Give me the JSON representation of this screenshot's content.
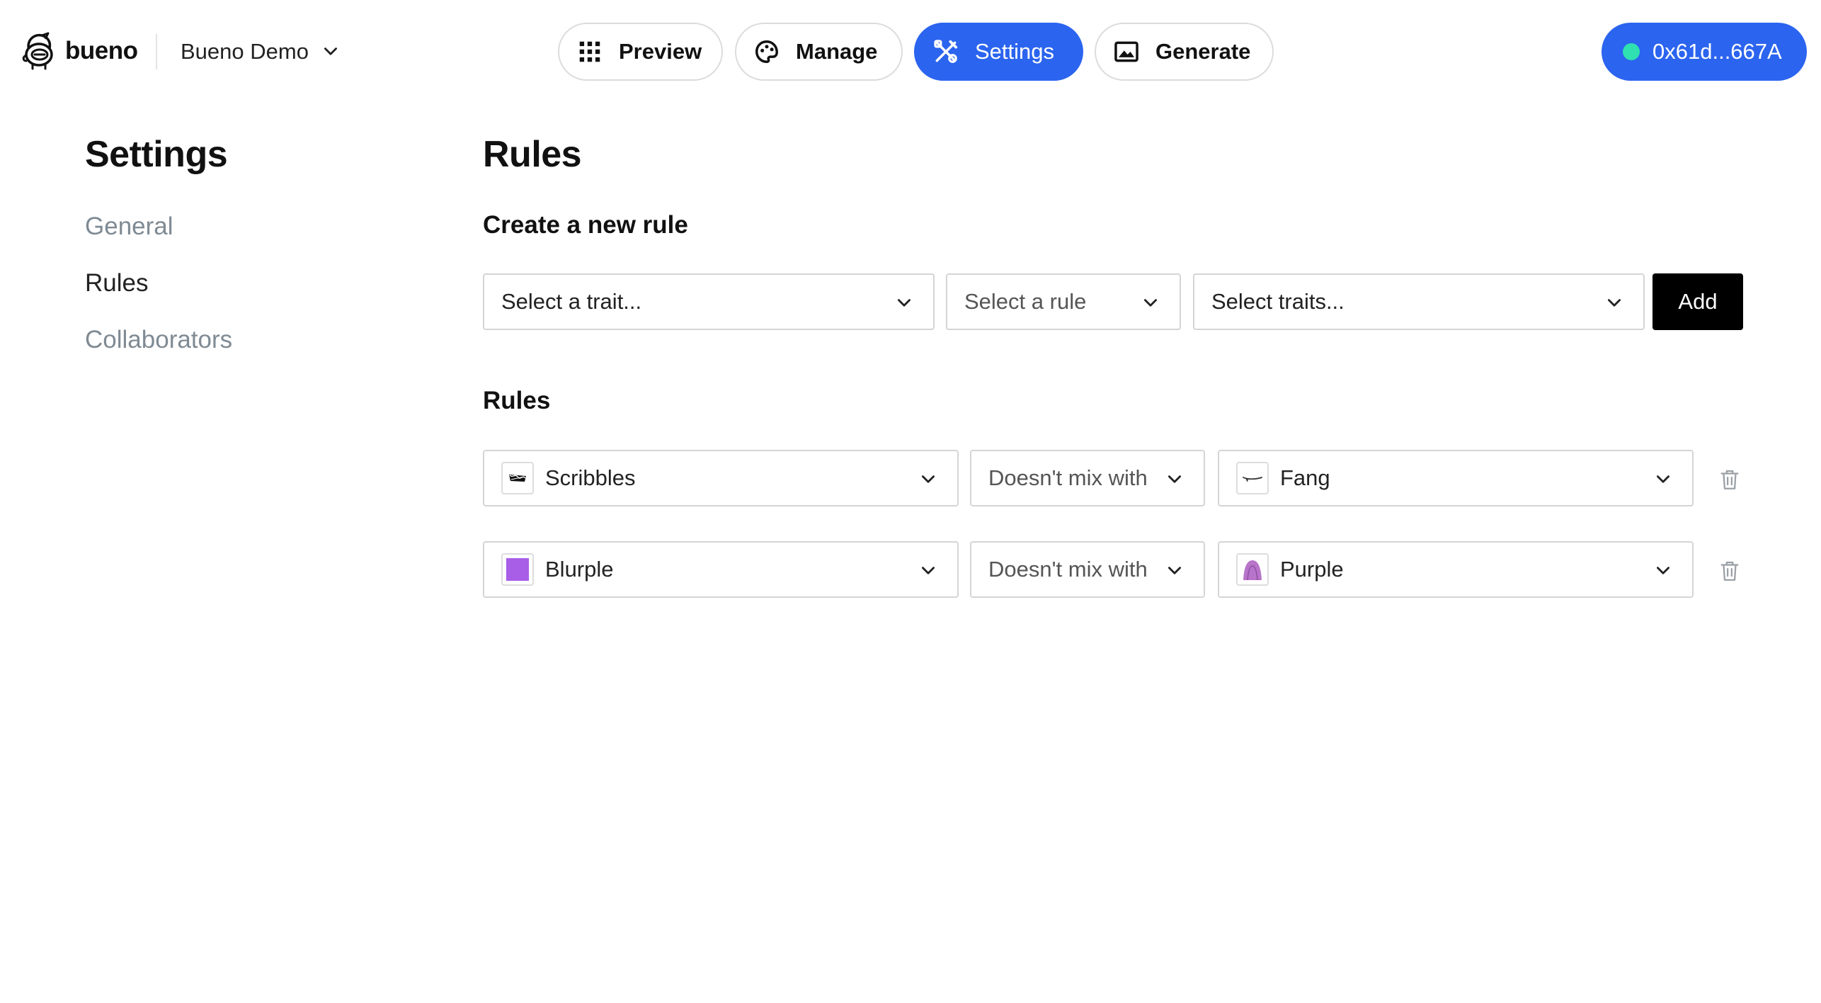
{
  "header": {
    "brand": "bueno",
    "project": "Bueno Demo",
    "nav": [
      {
        "label": "Preview",
        "icon": "grid-icon",
        "active": false
      },
      {
        "label": "Manage",
        "icon": "palette-icon",
        "active": false
      },
      {
        "label": "Settings",
        "icon": "tools-icon",
        "active": true
      },
      {
        "label": "Generate",
        "icon": "image-icon",
        "active": false
      }
    ],
    "wallet": "0x61d...667A"
  },
  "sidebar": {
    "title": "Settings",
    "items": [
      {
        "label": "General",
        "active": false
      },
      {
        "label": "Rules",
        "active": true
      },
      {
        "label": "Collaborators",
        "active": false
      }
    ]
  },
  "main": {
    "title": "Rules",
    "create": {
      "heading": "Create a new rule",
      "trait_placeholder": "Select a trait...",
      "rule_placeholder": "Select a rule",
      "traits_placeholder": "Select traits...",
      "add_label": "Add"
    },
    "rules_heading": "Rules",
    "rules": [
      {
        "trait": "Scribbles",
        "trait_icon": "scribbles-swatch",
        "rule": "Doesn't mix with",
        "target": "Fang",
        "target_icon": "fang-swatch"
      },
      {
        "trait": "Blurple",
        "trait_icon": "blurple-swatch",
        "rule": "Doesn't mix with",
        "target": "Purple",
        "target_icon": "purple-swatch"
      }
    ]
  },
  "colors": {
    "accent": "#2b64ef",
    "wallet_dot": "#2fe0b0",
    "blurple": "#a95ee8",
    "purple_swatch": "#b774c9",
    "muted_text": "#7f8a93"
  }
}
